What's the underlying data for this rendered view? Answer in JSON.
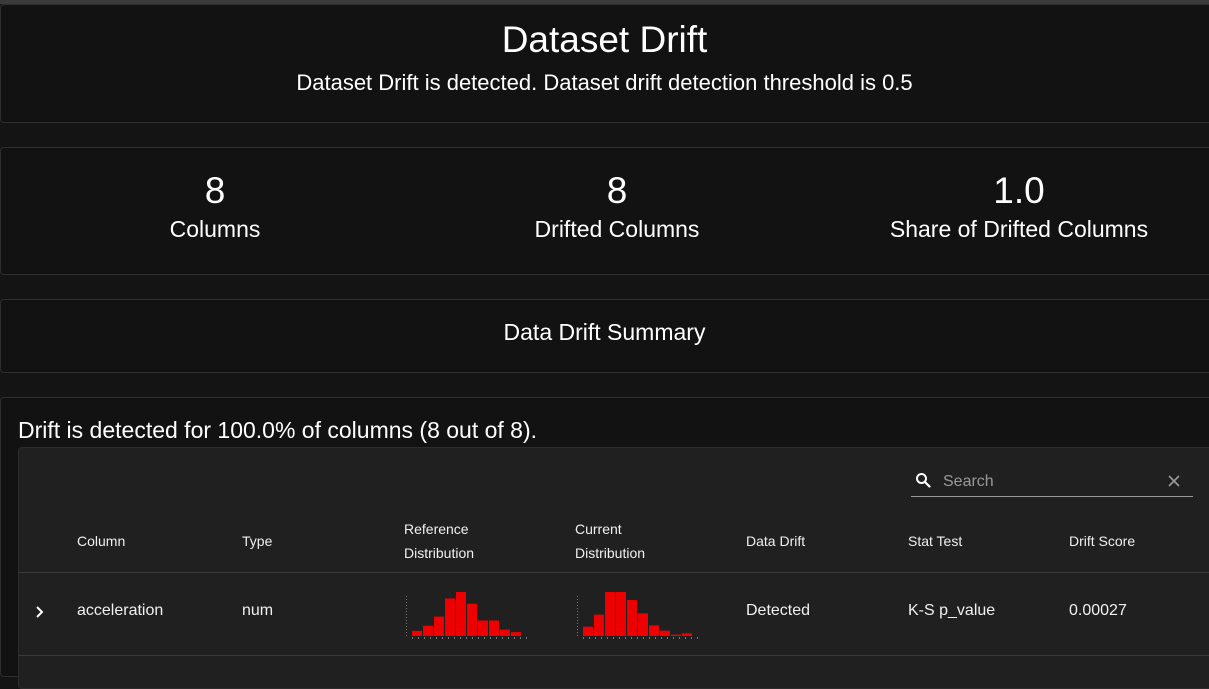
{
  "header": {
    "title": "Dataset Drift",
    "subtitle": "Dataset Drift is detected. Dataset drift detection threshold is 0.5"
  },
  "metrics": [
    {
      "value": "8",
      "label": "Columns"
    },
    {
      "value": "8",
      "label": "Drifted Columns"
    },
    {
      "value": "1.0",
      "label": "Share of Drifted Columns"
    }
  ],
  "summary": {
    "title": "Data Drift Summary"
  },
  "drift_note": "Drift is detected for 100.0% of columns (8 out of 8).",
  "search": {
    "placeholder": "Search"
  },
  "table": {
    "headers": {
      "column": "Column",
      "type": "Type",
      "reference_line1": "Reference",
      "reference_line2": "Distribution",
      "current_line1": "Current",
      "current_line2": "Distribution",
      "data_drift": "Data Drift",
      "stat_test": "Stat Test",
      "drift_score": "Drift Score"
    },
    "rows": [
      {
        "column": "acceleration",
        "type": "num",
        "data_drift": "Detected",
        "stat_test": "K-S p_value",
        "drift_score": "0.00027",
        "reference_hist": [
          4,
          8,
          15,
          29,
          34,
          25,
          12,
          12,
          5,
          3
        ],
        "current_hist": [
          7,
          16,
          33,
          33,
          27,
          17,
          8,
          4,
          1,
          2
        ]
      }
    ]
  },
  "colors": {
    "background": "#141414",
    "card": "#121212",
    "panel": "#202020",
    "histogram_bar": "#ee0000",
    "text": "#ffffff"
  }
}
